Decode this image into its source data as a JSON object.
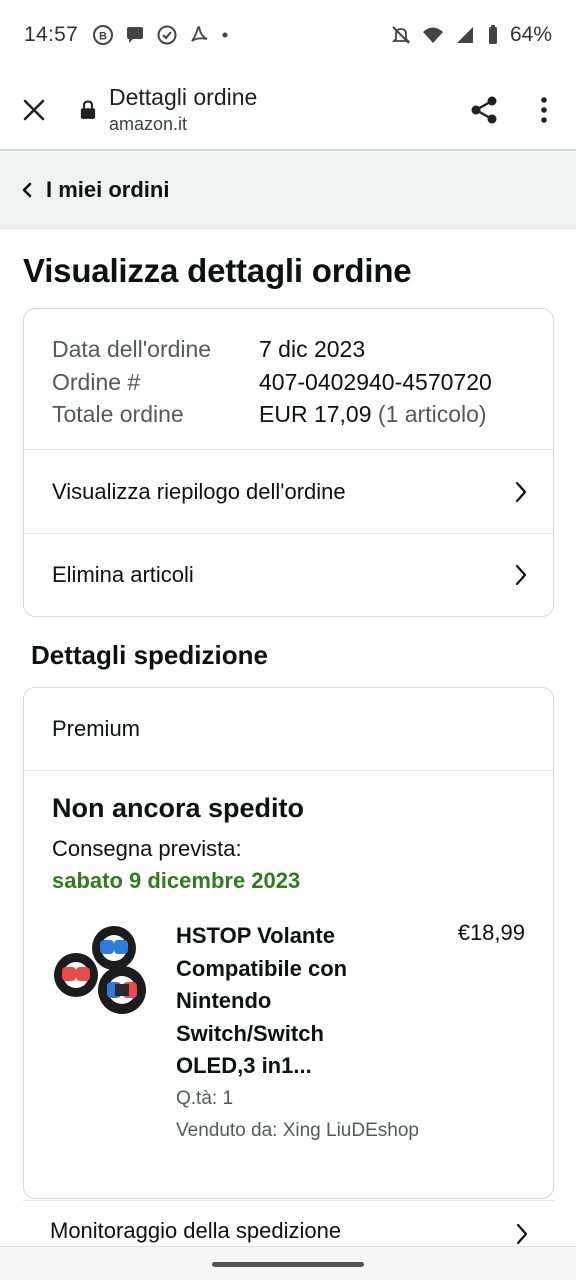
{
  "status_bar": {
    "time": "14:57",
    "battery": "64%",
    "notif_icons": [
      "b-circle-icon",
      "chat-bubble-icon",
      "check-circle-icon",
      "pdf-acrobat-icon",
      "dot-icon"
    ],
    "system_icons": [
      "muted-bell-icon",
      "wifi-icon",
      "signal-icon",
      "battery-icon"
    ]
  },
  "browser": {
    "page_title": "Dettagli ordine",
    "host": "amazon.it"
  },
  "back": {
    "label": "I miei ordini"
  },
  "page": {
    "title": "Visualizza dettagli ordine"
  },
  "order": {
    "rows": [
      {
        "key": "Data dell'ordine",
        "value": "7 dic 2023"
      },
      {
        "key": "Ordine #",
        "value": "407-0402940-4570720"
      },
      {
        "key": "Totale ordine",
        "value": "EUR 17,09",
        "extra": "(1 articolo)"
      }
    ],
    "links": [
      "Visualizza riepilogo dell'ordine",
      "Elimina articoli"
    ]
  },
  "shipping": {
    "section_title": "Dettagli spedizione",
    "method": "Premium",
    "status": "Non ancora spedito",
    "delivery_label": "Consegna prevista:",
    "delivery_date": "sabato 9 dicembre 2023",
    "item": {
      "title_lines": [
        "HSTOP Volante",
        "Compatibile con",
        "Nintendo",
        "Switch/Switch",
        "OLED,3 in1..."
      ],
      "price": "€18,99",
      "qty": "Q.tà: 1",
      "seller": "Venduto da: Xing LiuDEshop"
    },
    "track_label": "Monitoraggio della spedizione"
  },
  "colors": {
    "delivery_green": "#2e7d1f",
    "muted_text": "#565959",
    "border": "#d5d9d9",
    "backbar_bg": "#f0f2f2"
  }
}
